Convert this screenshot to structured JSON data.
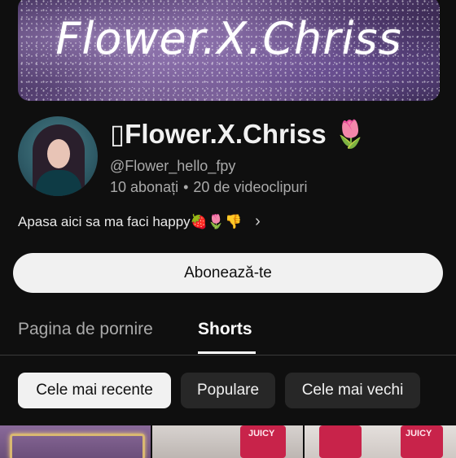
{
  "banner": {
    "text": "Flower.X.Chriss"
  },
  "channel": {
    "name": "▯Flower.X.Chriss 🌷",
    "handle": "@Flower_hello_fpy",
    "subscribers": "10 abonați",
    "videos": "20 de videoclipuri",
    "description": "Apasa aici sa ma faci happy🍓🌷👎",
    "chevron": "›"
  },
  "subscribe_button": {
    "label": "Abonează-te"
  },
  "tabs": [
    {
      "label": "Pagina de pornire",
      "selected": false
    },
    {
      "label": "Shorts",
      "selected": true
    }
  ],
  "filters": [
    {
      "label": "Cele mai recente",
      "selected": true
    },
    {
      "label": "Populare",
      "selected": false
    },
    {
      "label": "Cele mai vechi",
      "selected": false
    }
  ],
  "thumbnails": {
    "t2_label": "JUICY",
    "t3_label": "JUICY"
  },
  "colors": {
    "background": "#0f0f0f",
    "chip_selected": "#f1f1f1",
    "chip_default": "#272727",
    "secondary_text": "#aaaaaa"
  }
}
